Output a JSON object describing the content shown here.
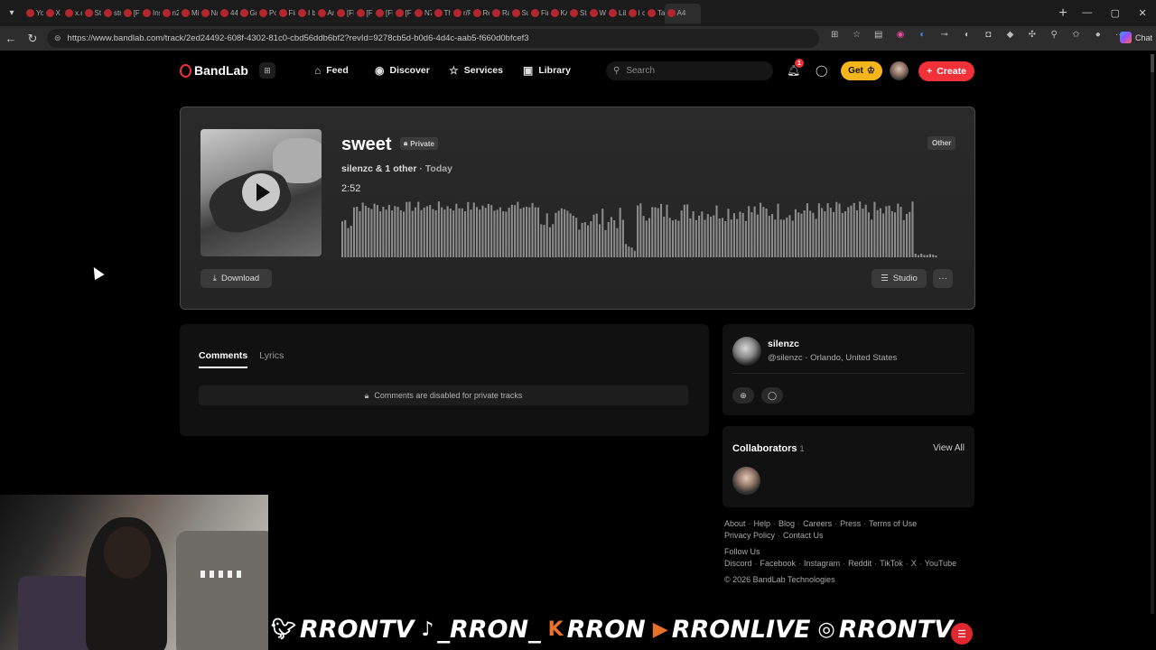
{
  "browser": {
    "tabs": [
      {
        "title": "Yo"
      },
      {
        "title": "X"
      },
      {
        "title": "x.c"
      },
      {
        "title": "Str"
      },
      {
        "title": "str"
      },
      {
        "title": "[FR"
      },
      {
        "title": "Ins"
      },
      {
        "title": "n2"
      },
      {
        "title": "Mi"
      },
      {
        "title": "Na"
      },
      {
        "title": "44"
      },
      {
        "title": "Gri"
      },
      {
        "title": "Po"
      },
      {
        "title": "Fin"
      },
      {
        "title": "I b"
      },
      {
        "title": "An"
      },
      {
        "title": "[FF"
      },
      {
        "title": "[FR"
      },
      {
        "title": "[FR"
      },
      {
        "title": "[FF"
      },
      {
        "title": "N7"
      },
      {
        "title": "The"
      },
      {
        "title": "r/P"
      },
      {
        "title": "Re"
      },
      {
        "title": "Ra"
      },
      {
        "title": "Su"
      },
      {
        "title": "Fin"
      },
      {
        "title": "KA"
      },
      {
        "title": "Str"
      },
      {
        "title": "We"
      },
      {
        "title": "Lib"
      },
      {
        "title": "I c"
      },
      {
        "title": "Tar"
      },
      {
        "title": "A4"
      }
    ],
    "url": "https://www.bandlab.com/track/2ed24492-608f-4302-81c0-cbd56ddb6bf2?revId=9278cb5d-b0d6-4d4c-aab5-f660d0bfcef3",
    "copilot_label": "Chat"
  },
  "nav": {
    "logo": "BandLab",
    "links": {
      "feed": "Feed",
      "discover": "Discover",
      "services": "Services",
      "library": "Library"
    },
    "search_placeholder": "Search",
    "notification_count": "1",
    "get_label": "Get",
    "create_label": "Create",
    "colors": {
      "brand": "#f0313a",
      "get": "#f7b51c"
    }
  },
  "track": {
    "title": "sweet",
    "privacy": "Private",
    "artist": "silenzc & 1 other",
    "date": "Today",
    "duration": "2:52",
    "genre": "Other",
    "download_label": "Download",
    "studio_label": "Studio",
    "more_label": "···"
  },
  "comments": {
    "tabs": [
      "Comments",
      "Lyrics"
    ],
    "disabled_message": "Comments are disabled for private tracks"
  },
  "artist": {
    "name": "silenzc",
    "handle": "@silenzc",
    "location": "Orlando, United States"
  },
  "collaborators": {
    "title": "Collaborators",
    "count": "1",
    "view_all": "View All"
  },
  "footer": {
    "links_row1": [
      "About",
      "Help",
      "Blog",
      "Careers",
      "Press",
      "Terms of Use"
    ],
    "links_row2": [
      "Privacy Policy",
      "Contact Us"
    ],
    "follow_us": "Follow Us",
    "social_links": [
      "Discord",
      "Facebook",
      "Instagram",
      "Reddit",
      "TikTok",
      "X",
      "YouTube"
    ],
    "copyright": "© 2026 BandLab Technologies"
  },
  "stream_overlay": {
    "twitter": "RRONTV",
    "tiktok": "_RRON_",
    "kick": "RRON",
    "youtube": "RRONLIVE",
    "instagram": "RRONTV"
  }
}
